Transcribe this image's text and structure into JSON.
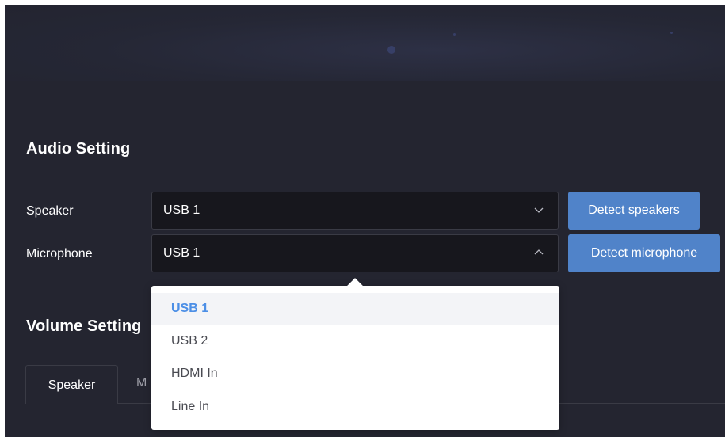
{
  "audio_setting": {
    "title": "Audio Setting",
    "speaker_label": "Speaker",
    "speaker_value": "USB 1",
    "microphone_label": "Microphone",
    "microphone_value": "USB 1",
    "detect_speakers_label": "Detect speakers",
    "detect_microphone_label": "Detect microphone"
  },
  "volume_setting": {
    "title_visible": "Volume Setting",
    "tabs": [
      {
        "label": "Speaker",
        "active": true
      },
      {
        "label": "M",
        "active": false
      }
    ]
  },
  "microphone_dropdown": {
    "open": true,
    "options": [
      {
        "label": "USB 1",
        "selected": true
      },
      {
        "label": "USB 2",
        "selected": false
      },
      {
        "label": "HDMI In",
        "selected": false
      },
      {
        "label": "Line In",
        "selected": false
      }
    ]
  },
  "colors": {
    "background": "#242530",
    "select_bg": "#17171d",
    "button": "#5083c9",
    "selected_option": "#4c8fe6"
  },
  "icons": {
    "speaker_chevron": "chevron-down-icon",
    "microphone_chevron": "chevron-up-icon"
  }
}
